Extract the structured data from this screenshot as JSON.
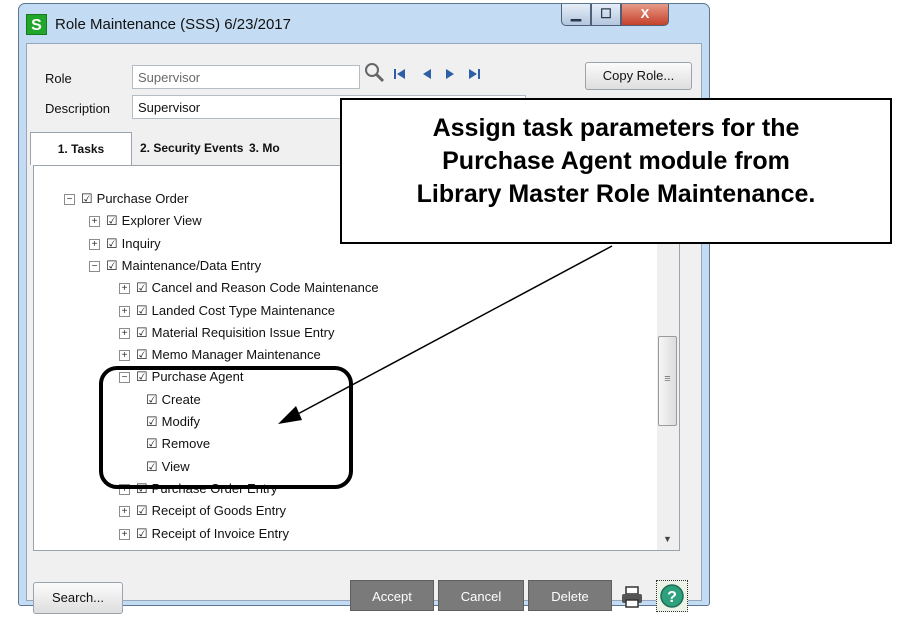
{
  "window": {
    "title": "Role Maintenance (SSS) 6/23/2017",
    "app_icon_letter": "S",
    "min_glyph": "▁",
    "max_glyph": "☐",
    "close_glyph": "X"
  },
  "form": {
    "role_label": "Role",
    "role_value": "Supervisor",
    "description_label": "Description",
    "description_value": "Supervisor",
    "copy_role_button": "Copy Role..."
  },
  "nav_icons": [
    "search-icon",
    "first-record-icon",
    "previous-record-icon",
    "next-record-icon",
    "last-record-icon"
  ],
  "tabs": [
    {
      "label": "1. Tasks"
    },
    {
      "label": "2. Security Events"
    },
    {
      "label": "3. Mo"
    }
  ],
  "tree": [
    {
      "label": "Purchase Order",
      "expander": "−",
      "level": 0
    },
    {
      "label": "Explorer View",
      "expander": "+",
      "level": 1
    },
    {
      "label": "Inquiry",
      "expander": "+",
      "level": 1
    },
    {
      "label": "Maintenance/Data Entry",
      "expander": "−",
      "level": 1
    },
    {
      "label": "Cancel and Reason Code Maintenance",
      "expander": "+",
      "level": 2
    },
    {
      "label": "Landed Cost Type Maintenance",
      "expander": "+",
      "level": 2
    },
    {
      "label": "Material Requisition Issue Entry",
      "expander": "+",
      "level": 2
    },
    {
      "label": "Memo Manager Maintenance",
      "expander": "+",
      "level": 2
    },
    {
      "label": "Purchase Agent",
      "expander": "−",
      "level": 2
    },
    {
      "label": "Create",
      "expander": "",
      "level": 3
    },
    {
      "label": "Modify",
      "expander": "",
      "level": 3
    },
    {
      "label": "Remove",
      "expander": "",
      "level": 3
    },
    {
      "label": "View",
      "expander": "",
      "level": 3
    },
    {
      "label": "Purchase Order Entry",
      "expander": "+",
      "level": 2
    },
    {
      "label": "Receipt of Goods Entry",
      "expander": "+",
      "level": 2
    },
    {
      "label": "Receipt of Invoice Entry",
      "expander": "+",
      "level": 2
    }
  ],
  "footer": {
    "search_button": "Search...",
    "accept_button": "Accept",
    "cancel_button": "Cancel",
    "delete_button": "Delete"
  },
  "callout": {
    "line1": "Assign task parameters for the",
    "line2": "Purchase Agent module from",
    "line3": "Library Master Role Maintenance."
  }
}
